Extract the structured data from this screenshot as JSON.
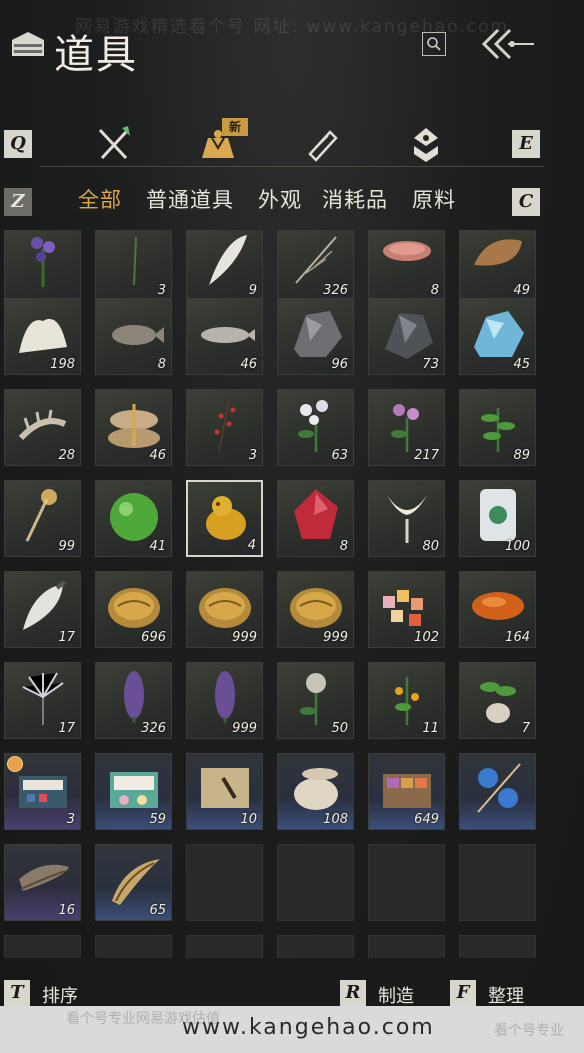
{
  "watermark": {
    "top": "网易游戏精选看个号  网址: www.kangehao.com",
    "bottom": "www.kangehao.com",
    "bottom_faint_left": "看个号专业网易游戏估值",
    "bottom_faint_right": "看个号专业"
  },
  "header": {
    "title": "道具",
    "icons": [
      "bag-icon",
      "search-icon",
      "back-arrow-icon"
    ]
  },
  "tabs": {
    "left_key": "Q",
    "right_key": "E",
    "new_badge": "新",
    "items": [
      {
        "icon": "crossed-swords-icon"
      },
      {
        "icon": "pouch-icon",
        "active": true
      },
      {
        "icon": "scroll-icon"
      },
      {
        "icon": "spirit-icon"
      }
    ]
  },
  "categories": {
    "left_key": "Z",
    "right_key": "C",
    "items": [
      {
        "label": "全部",
        "active": true
      },
      {
        "label": "普通道具"
      },
      {
        "label": "外观"
      },
      {
        "label": "消耗品"
      },
      {
        "label": "原料"
      }
    ]
  },
  "grid": {
    "rows": [
      [
        {
          "item": "lavender-herb",
          "qty": "",
          "tint": "filled"
        },
        {
          "item": "grass-sprout",
          "qty": "3",
          "tint": "filled"
        },
        {
          "item": "white-feather",
          "qty": "9",
          "tint": "filled"
        },
        {
          "item": "dry-herb",
          "qty": "326",
          "tint": "filled"
        },
        {
          "item": "raw-meat",
          "qty": "8",
          "tint": "filled"
        },
        {
          "item": "fur-pelt",
          "qty": "49",
          "tint": "filled"
        }
      ],
      [
        {
          "item": "white-coral",
          "qty": "198",
          "tint": "filled"
        },
        {
          "item": "fish-grey",
          "qty": "8",
          "tint": "filled"
        },
        {
          "item": "fish-silver",
          "qty": "46",
          "tint": "filled"
        },
        {
          "item": "iron-ore",
          "qty": "96",
          "tint": "filled"
        },
        {
          "item": "dark-ore",
          "qty": "73",
          "tint": "filled"
        },
        {
          "item": "blue-crystal",
          "qty": "45",
          "tint": "filled"
        }
      ],
      [
        {
          "item": "bone-spine",
          "qty": "28",
          "tint": "filled"
        },
        {
          "item": "rice-bundle",
          "qty": "46",
          "tint": "filled"
        },
        {
          "item": "red-berries",
          "qty": "3",
          "tint": "filled"
        },
        {
          "item": "white-flower",
          "qty": "63",
          "tint": "filled"
        },
        {
          "item": "pink-flower",
          "qty": "217",
          "tint": "filled"
        },
        {
          "item": "green-plant",
          "qty": "89",
          "tint": "filled"
        }
      ],
      [
        {
          "item": "sparkler-torch",
          "qty": "99",
          "tint": "filled"
        },
        {
          "item": "green-orb",
          "qty": "41",
          "tint": "filled"
        },
        {
          "item": "gold-toad",
          "qty": "4",
          "tint": "filled",
          "selected": true
        },
        {
          "item": "red-gem",
          "qty": "8",
          "tint": "filled"
        },
        {
          "item": "white-lily",
          "qty": "80",
          "tint": "filled"
        },
        {
          "item": "jade-tablet",
          "qty": "100",
          "tint": "filled"
        }
      ],
      [
        {
          "item": "white-plume",
          "qty": "17",
          "tint": "filled"
        },
        {
          "item": "gold-shell",
          "qty": "696",
          "tint": "filled"
        },
        {
          "item": "gold-shell",
          "qty": "999",
          "tint": "filled"
        },
        {
          "item": "gold-shell",
          "qty": "999",
          "tint": "filled"
        },
        {
          "item": "candy-pieces",
          "qty": "102",
          "tint": "filled"
        },
        {
          "item": "orange-stone",
          "qty": "164",
          "tint": "filled"
        }
      ],
      [
        {
          "item": "silver-spider-lily",
          "qty": "17",
          "tint": "filled"
        },
        {
          "item": "purple-spike",
          "qty": "326",
          "tint": "filled"
        },
        {
          "item": "purple-spike",
          "qty": "999",
          "tint": "filled"
        },
        {
          "item": "stone-flower",
          "qty": "50",
          "tint": "filled"
        },
        {
          "item": "orange-fruit-plant",
          "qty": "11",
          "tint": "filled"
        },
        {
          "item": "potted-plant",
          "qty": "7",
          "tint": "filled"
        }
      ],
      [
        {
          "item": "gift-box-blue",
          "qty": "3",
          "tint": "purple",
          "timer": true
        },
        {
          "item": "gift-box-teal",
          "qty": "59",
          "tint": "blue"
        },
        {
          "item": "ink-scroll",
          "qty": "10",
          "tint": "blue"
        },
        {
          "item": "ceramic-jar",
          "qty": "108",
          "tint": "blue"
        },
        {
          "item": "gift-box-brown",
          "qty": "649",
          "tint": "blue"
        },
        {
          "item": "blue-bird-pair",
          "qty": "",
          "tint": "blue"
        }
      ],
      [
        {
          "item": "horn-dark",
          "qty": "16",
          "tint": "purple"
        },
        {
          "item": "horn-light",
          "qty": "65",
          "tint": "blue"
        },
        {
          "item": "",
          "qty": "",
          "tint": "empty"
        },
        {
          "item": "",
          "qty": "",
          "tint": "empty"
        },
        {
          "item": "",
          "qty": "",
          "tint": "empty"
        },
        {
          "item": "",
          "qty": "",
          "tint": "empty"
        }
      ],
      [
        {
          "item": "",
          "qty": "",
          "tint": "empty"
        },
        {
          "item": "",
          "qty": "",
          "tint": "empty"
        },
        {
          "item": "",
          "qty": "",
          "tint": "empty"
        },
        {
          "item": "",
          "qty": "",
          "tint": "empty"
        },
        {
          "item": "",
          "qty": "",
          "tint": "empty"
        },
        {
          "item": "",
          "qty": "",
          "tint": "empty"
        }
      ]
    ]
  },
  "bottom": {
    "sort_key": "T",
    "sort_label": "排序",
    "craft_key": "R",
    "craft_label": "制造",
    "tidy_key": "F",
    "tidy_label": "整理"
  }
}
